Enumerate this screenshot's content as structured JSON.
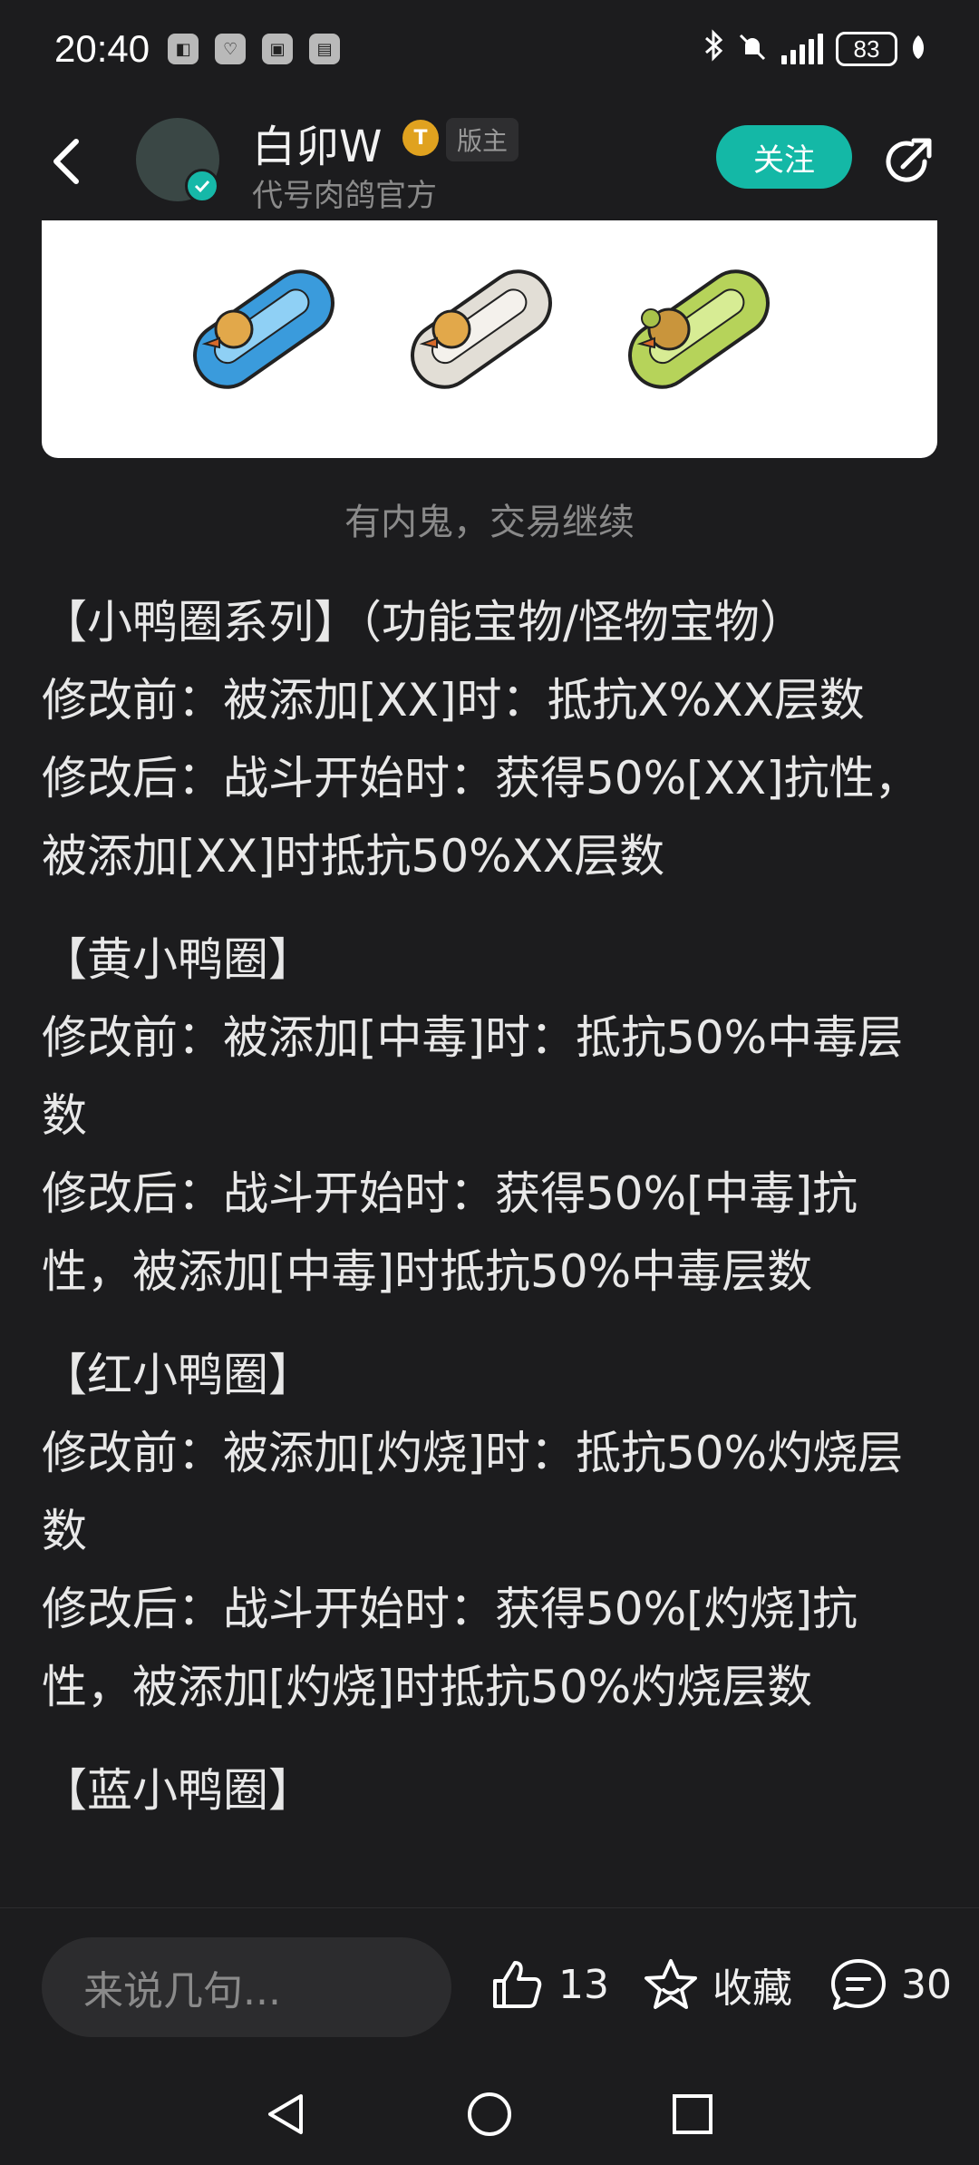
{
  "status_bar": {
    "time": "20:40",
    "battery": "83",
    "app_icons": [
      "app-icon-1",
      "app-icon-2",
      "app-icon-3",
      "app-icon-4"
    ]
  },
  "header": {
    "user_name": "白卯W",
    "level_badge": "T",
    "role_badge": "版主",
    "subtitle": "代号肉鸽官方",
    "follow_label": "关注"
  },
  "image": {
    "caption": "有内鬼，交易继续",
    "items": [
      {
        "name": "blue-duck-ring",
        "color": "#3a9bdc"
      },
      {
        "name": "white-duck-ring",
        "color": "#e2ded6"
      },
      {
        "name": "green-duck-ring",
        "color": "#b6d35a"
      }
    ]
  },
  "article": {
    "blocks": [
      {
        "title": "【小鸭圈系列】（功能宝物/怪物宝物）",
        "before": "修改前：被添加[XX]时：抵抗X%XX层数",
        "after": "修改后：战斗开始时：获得50%[XX]抗性，被添加[XX]时抵抗50%XX层数"
      },
      {
        "title": "【黄小鸭圈】",
        "before": "修改前：被添加[中毒]时：抵抗50%中毒层数",
        "after": "修改后：战斗开始时：获得50%[中毒]抗性，被添加[中毒]时抵抗50%中毒层数"
      },
      {
        "title": "【红小鸭圈】",
        "before": "修改前：被添加[灼烧]时：抵抗50%灼烧层数",
        "after": "修改后：战斗开始时：获得50%[灼烧]抗性，被添加[灼烧]时抵抗50%灼烧层数"
      },
      {
        "title": "【蓝小鸭圈】"
      }
    ]
  },
  "bottom_bar": {
    "comment_placeholder": "来说几句...",
    "like_count": "13",
    "favorite_label": "收藏",
    "comment_count": "30"
  }
}
